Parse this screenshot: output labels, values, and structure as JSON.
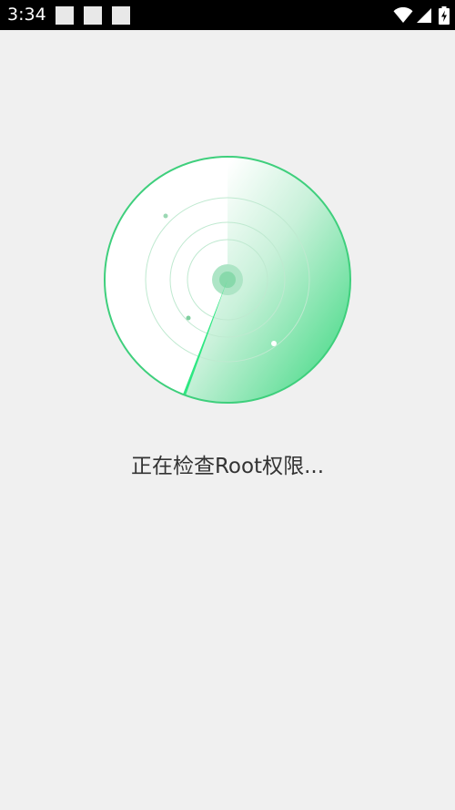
{
  "status_bar": {
    "time": "3:34"
  },
  "main": {
    "status_message": "正在检查Root权限..."
  },
  "colors": {
    "background": "#f0f0f0",
    "status_bar": "#000000",
    "radar_outline": "#3ecf7c",
    "radar_fill": "#5ede96",
    "text": "#333333"
  }
}
